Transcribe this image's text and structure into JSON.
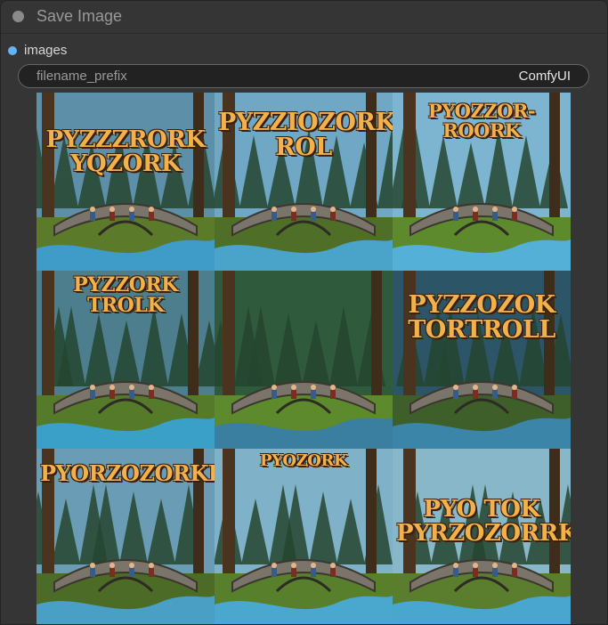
{
  "node": {
    "title": "Save Image"
  },
  "output": {
    "label": "images",
    "color": "#64b5f6"
  },
  "widget": {
    "name": "filename_prefix",
    "value": "ComfyUI"
  },
  "images": [
    {
      "caption": "PYZZZRORK YQZORK",
      "sky": "#5e8fa8",
      "ground": "#5b7a2a",
      "water": "#3f9bc7"
    },
    {
      "caption": "PYZZIOZORK ROL",
      "sky": "#6fa7c4",
      "ground": "#4f6e27",
      "water": "#4aa3c9"
    },
    {
      "caption": "PYOZZOR-ROORK",
      "sky": "#7db4cf",
      "ground": "#5e8a2e",
      "water": "#54b0d6"
    },
    {
      "caption": "PYZZORK TROLK",
      "sky": "#4c7e8e",
      "ground": "#557a2a",
      "water": "#3aa0c8"
    },
    {
      "caption": "",
      "sky": "#2f5a3b",
      "ground": "#5c8a2c",
      "water": "#3b7fa0"
    },
    {
      "caption": "PYZZOZOK TORTROLL",
      "sky": "#2d5568",
      "ground": "#3e5f2a",
      "water": "#3b85a8"
    },
    {
      "caption": "PYORZOZORKKL",
      "sky": "#6a9db5",
      "ground": "#4c6b27",
      "water": "#4aa0c4"
    },
    {
      "caption": "PYOZORK",
      "sky": "#7fb1c8",
      "ground": "#577f2c",
      "water": "#4aa8cf"
    },
    {
      "caption": "PYO TOK PYRZOZORRK",
      "sky": "#88b7c9",
      "ground": "#5a7d2e",
      "water": "#49a6cf"
    }
  ]
}
